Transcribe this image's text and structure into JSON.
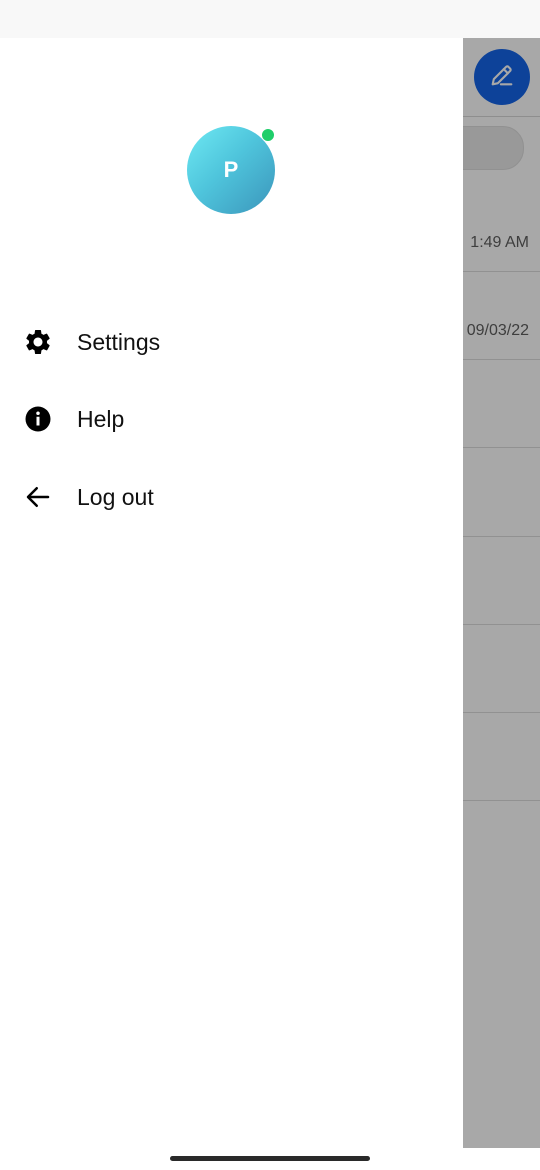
{
  "colors": {
    "accent": "#1565e8",
    "presence": "#1fce6a",
    "avatar_gradient_start": "#6ee9f3",
    "avatar_gradient_end": "#3b95bb"
  },
  "drawer": {
    "avatar_initial": "P",
    "menu": [
      {
        "label": "Settings",
        "icon": "gear-icon"
      },
      {
        "label": "Help",
        "icon": "info-icon"
      },
      {
        "label": "Log out",
        "icon": "arrow-left-icon"
      }
    ]
  },
  "background": {
    "compose_icon": "pencil-icon",
    "rows": [
      {
        "time": "1:49 AM"
      },
      {
        "time": "09/03/22"
      }
    ]
  }
}
